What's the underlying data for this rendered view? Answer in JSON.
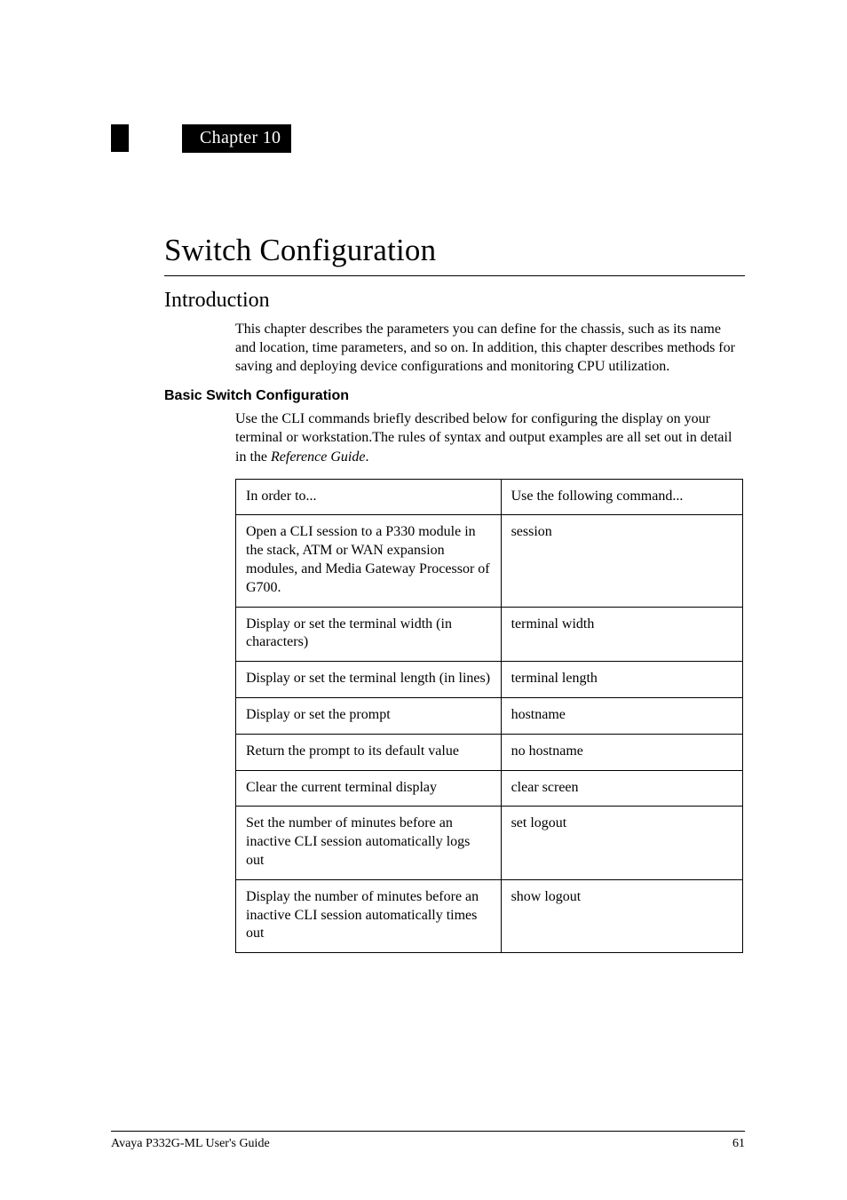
{
  "chapter_label": "Chapter 10",
  "title": "Switch Configuration",
  "section_heading": "Introduction",
  "intro_paragraph": "This chapter describes the parameters you can define for the chassis, such as its name and location, time parameters, and so on. In addition, this chapter describes methods for saving and deploying device configurations and monitoring CPU utilization.",
  "subheading": "Basic Switch Configuration",
  "sub_paragraph_pre": "Use the CLI commands briefly described below for configuring the display on your terminal or workstation.The rules of syntax and output examples are all set out in detail in the ",
  "sub_paragraph_italic": "Reference Guide",
  "sub_paragraph_post": ".",
  "table_header_left": "In order to...",
  "table_header_right": "Use the following command...",
  "rows": [
    {
      "left": "Open a CLI session to a P330 module in the stack, ATM or WAN expansion modules, and Media Gateway Processor of G700.",
      "right": "session"
    },
    {
      "left": "Display or set the terminal width (in characters)",
      "right": "terminal width"
    },
    {
      "left": "Display or set the terminal length (in lines)",
      "right": "terminal length"
    },
    {
      "left": "Display or set the prompt",
      "right": "hostname"
    },
    {
      "left": "Return the prompt to its default value",
      "right": "no hostname"
    },
    {
      "left": "Clear the current terminal display",
      "right": "clear screen"
    },
    {
      "left": "Set the number of minutes before an inactive CLI session automatically logs out",
      "right": "set logout"
    },
    {
      "left": "Display the number of minutes before an inactive CLI session automatically times out",
      "right": "show logout"
    }
  ],
  "footer_left": "Avaya P332G-ML User's Guide",
  "footer_right": "61"
}
